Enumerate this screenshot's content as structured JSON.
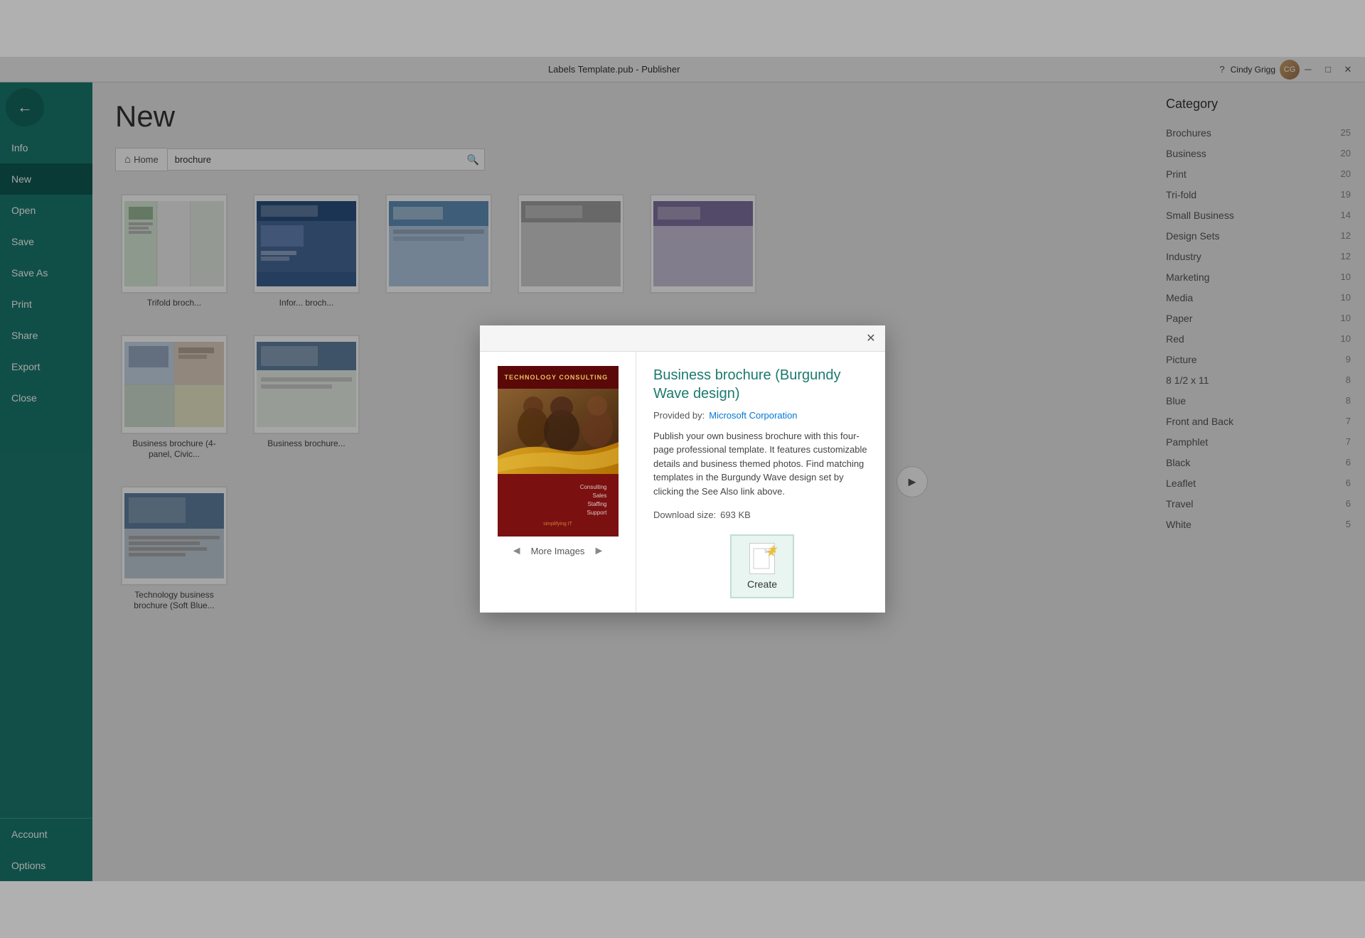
{
  "window": {
    "title": "Labels Template.pub - Publisher",
    "help_label": "?",
    "minimize_label": "─",
    "maximize_label": "□",
    "close_label": "✕",
    "user_name": "Cindy Grigg"
  },
  "sidebar": {
    "back_label": "←",
    "items": [
      {
        "id": "info",
        "label": "Info",
        "active": false
      },
      {
        "id": "new",
        "label": "New",
        "active": true
      },
      {
        "id": "open",
        "label": "Open",
        "active": false
      },
      {
        "id": "save",
        "label": "Save",
        "active": false
      },
      {
        "id": "save-as",
        "label": "Save As",
        "active": false
      },
      {
        "id": "print",
        "label": "Print",
        "active": false
      },
      {
        "id": "share",
        "label": "Share",
        "active": false
      },
      {
        "id": "export",
        "label": "Export",
        "active": false
      },
      {
        "id": "close",
        "label": "Close",
        "active": false
      }
    ],
    "bottom_items": [
      {
        "id": "account",
        "label": "Account"
      },
      {
        "id": "options",
        "label": "Options"
      }
    ]
  },
  "main": {
    "page_title": "New",
    "breadcrumb_home": "Home",
    "search_placeholder": "brochure",
    "search_icon": "🔍"
  },
  "templates": [
    {
      "id": "trifold",
      "name": "Trifold broch...",
      "type": "trifold"
    },
    {
      "id": "info",
      "name": "Infor... broch...",
      "type": "info"
    },
    {
      "id": "blue",
      "name": "",
      "type": "blue"
    },
    {
      "id": "gray",
      "name": "",
      "type": "gray"
    },
    {
      "id": "purple",
      "name": "",
      "type": "purple"
    },
    {
      "id": "business-4panel",
      "name": "Business brochure (4-panel, Civic...",
      "type": "business"
    },
    {
      "id": "business2",
      "name": "Business brochure...",
      "type": "business2"
    },
    {
      "id": "tech",
      "name": "Technology business brochure (Soft Blue...",
      "type": "tech"
    }
  ],
  "categories": {
    "title": "Category",
    "items": [
      {
        "label": "Brochures",
        "count": "25"
      },
      {
        "label": "Business",
        "count": "20"
      },
      {
        "label": "Print",
        "count": "20"
      },
      {
        "label": "Tri-fold",
        "count": "19"
      },
      {
        "label": "Small Business",
        "count": "14"
      },
      {
        "label": "Design Sets",
        "count": "12"
      },
      {
        "label": "Industry",
        "count": "12"
      },
      {
        "label": "Marketing",
        "count": "10"
      },
      {
        "label": "Media",
        "count": "10"
      },
      {
        "label": "Paper",
        "count": "10"
      },
      {
        "label": "Red",
        "count": "10"
      },
      {
        "label": "Picture",
        "count": "9"
      },
      {
        "label": "8 1/2 x 11",
        "count": "8"
      },
      {
        "label": "Blue",
        "count": "8"
      },
      {
        "label": "Front and Back",
        "count": "7"
      },
      {
        "label": "Pamphlet",
        "count": "7"
      },
      {
        "label": "Black",
        "count": "6"
      },
      {
        "label": "Leaflet",
        "count": "6"
      },
      {
        "label": "Travel",
        "count": "6"
      },
      {
        "label": "White",
        "count": "5"
      }
    ]
  },
  "modal": {
    "product_title": "Business brochure (Burgundy Wave design)",
    "provided_by_label": "Provided by:",
    "provider_name": "Microsoft Corporation",
    "description": "Publish your own business brochure with this four-page professional template. It features customizable details and business themed photos. Find matching templates in the Burgundy Wave design set by clicking the See Also link above.",
    "download_label": "Download size:",
    "download_size": "693 KB",
    "more_images_label": "More Images",
    "create_label": "Create",
    "close_label": "✕",
    "brochure_title": "TECHNOLOGY CONSULTING",
    "brochure_lines": [
      "Consulting",
      "Sales",
      "Staffing",
      "Support"
    ],
    "brochure_footer": "simplifying IT",
    "nav_prev": "◄",
    "nav_next": "►"
  },
  "colors": {
    "teal": "#1a7a6e",
    "teal_dark": "#0e5a52",
    "burgundy": "#7a1010",
    "gold": "#e8c060",
    "link_blue": "#0078d7",
    "modal_title": "#1a7a6e"
  }
}
